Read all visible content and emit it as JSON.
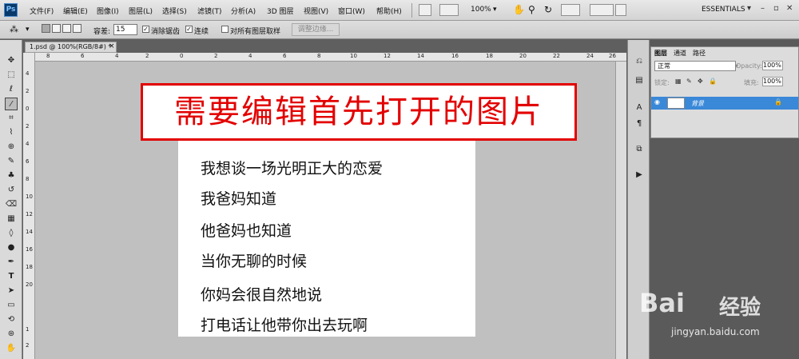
{
  "app": {
    "logo": "Ps",
    "workspace": "ESSENTIALS",
    "zoom": "100%"
  },
  "menu": [
    "文件(F)",
    "编辑(E)",
    "图像(I)",
    "图层(L)",
    "选择(S)",
    "滤镜(T)",
    "分析(A)",
    "3D 图层",
    "视图(V)",
    "窗口(W)",
    "帮助(H)"
  ],
  "options": {
    "tolerance_label": "容差:",
    "tolerance_value": "15",
    "antialias_label": "消除锯齿",
    "contiguous_label": "连续",
    "sample_all_label": "对所有图层取样",
    "refine_edge_label": "调整边缘..."
  },
  "document": {
    "tab_title": "1.psd @ 100%(RGB/8#) *",
    "close": "×",
    "ruler_top": [
      "8",
      "6",
      "4",
      "2",
      "0",
      "2",
      "4",
      "6",
      "8",
      "10",
      "12",
      "14",
      "16",
      "18",
      "20",
      "22",
      "24",
      "26"
    ],
    "ruler_left": [
      "4",
      "2",
      "0",
      "2",
      "4",
      "6",
      "8",
      "10",
      "12",
      "14",
      "16",
      "18",
      "20",
      "1",
      "2"
    ],
    "banner_title": "需要编辑首先打开的图片",
    "poem_lines": [
      "我想谈一场光明正大的恋爱",
      "我爸妈知道",
      "他爸妈也知道",
      "当你无聊的时候",
      "你妈会很自然地说",
      "打电话让他带你出去玩啊"
    ]
  },
  "layers_panel": {
    "tabs": [
      "图层",
      "通道",
      "路径"
    ],
    "blend_mode": "正常",
    "opacity_label": "Opacity:",
    "opacity_value": "100%",
    "lock_label": "锁定:",
    "fill_label": "填充:",
    "fill_value": "100%",
    "layer_name": "背景"
  },
  "watermark": {
    "brand": "Bai",
    "brand_cn": "经验",
    "url": "jingyan.baidu.com"
  },
  "colors": {
    "banner_red": "#e30000",
    "layer_highlight": "#3a88d8"
  }
}
